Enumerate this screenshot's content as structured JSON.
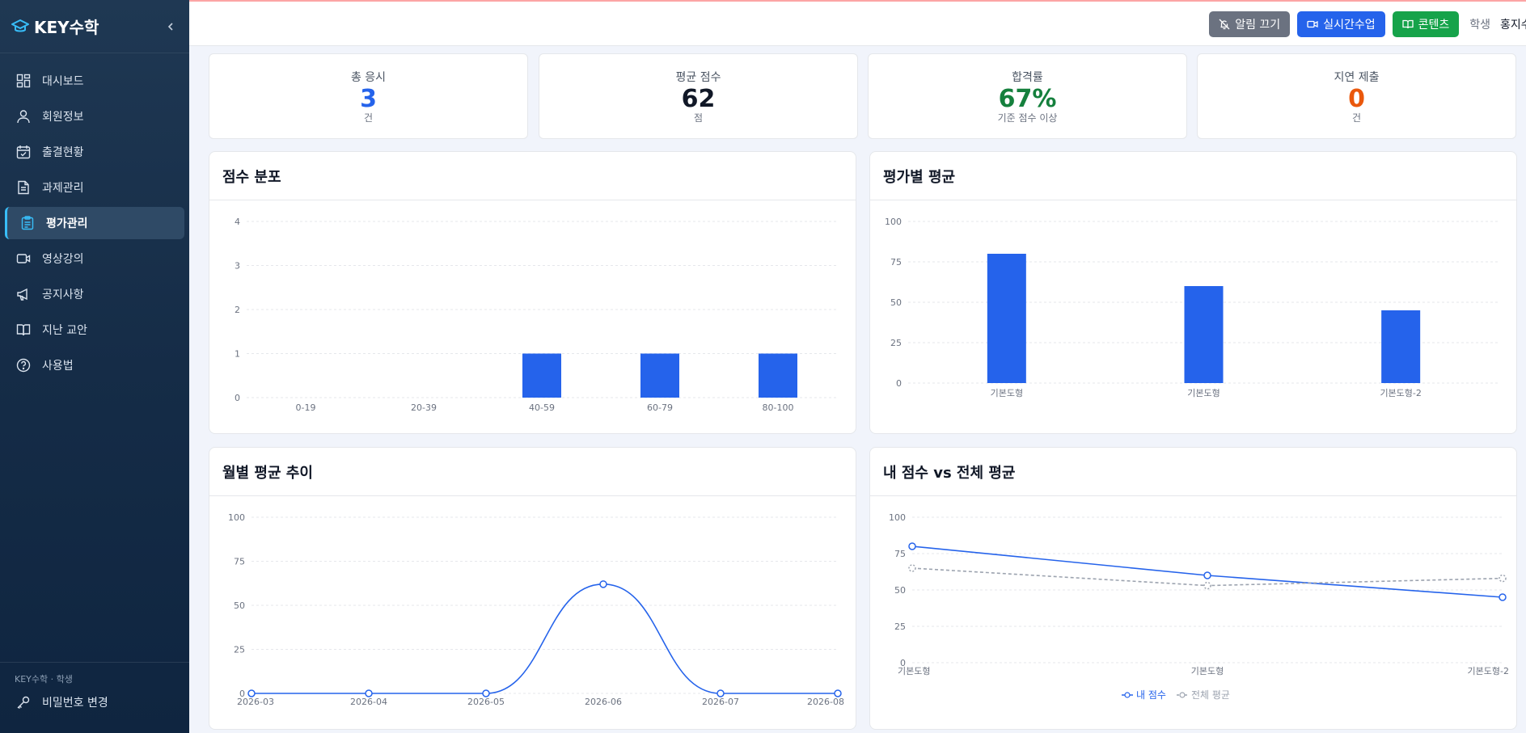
{
  "app": {
    "title": "KEY수학",
    "footer_role": "KEY수학 · 학생",
    "password_change": "비밀번호 변경"
  },
  "sidebar": {
    "items": [
      {
        "label": "대시보드",
        "icon": "dashboard-icon"
      },
      {
        "label": "회원정보",
        "icon": "user-icon"
      },
      {
        "label": "출결현황",
        "icon": "calendar-check-icon"
      },
      {
        "label": "과제관리",
        "icon": "document-icon"
      },
      {
        "label": "평가관리",
        "icon": "clipboard-icon",
        "active": true
      },
      {
        "label": "영상강의",
        "icon": "video-icon"
      },
      {
        "label": "공지사항",
        "icon": "megaphone-icon"
      },
      {
        "label": "지난 교안",
        "icon": "book-icon"
      },
      {
        "label": "사용법",
        "icon": "help-icon"
      }
    ]
  },
  "topbar": {
    "notify_off": "알림 끄기",
    "live_class": "실시간수업",
    "contents": "콘텐츠",
    "user_role": "학생",
    "user_name": "홍지수"
  },
  "stats": [
    {
      "label": "총 응시",
      "value": "3",
      "unit": "건",
      "color": "#2563eb"
    },
    {
      "label": "평균 점수",
      "value": "62",
      "unit": "점",
      "color": "#111827"
    },
    {
      "label": "합격률",
      "value": "67%",
      "unit": "기준 점수 이상",
      "color": "#15803d"
    },
    {
      "label": "지연 제출",
      "value": "0",
      "unit": "건",
      "color": "#ea580c"
    }
  ],
  "chart_data": [
    {
      "title": "점수 분포",
      "type": "bar",
      "categories": [
        "0-19",
        "20-39",
        "40-59",
        "60-79",
        "80-100"
      ],
      "values": [
        0,
        0,
        1,
        1,
        1
      ],
      "ylim": [
        0,
        4
      ],
      "yticks": [
        0,
        1,
        2,
        3,
        4
      ],
      "color": "#2563eb",
      "grid": true
    },
    {
      "title": "평가별 평균",
      "type": "bar",
      "categories": [
        "기본도형",
        "기본도형",
        "기본도형-2"
      ],
      "values": [
        80,
        60,
        45
      ],
      "ylim": [
        0,
        100
      ],
      "yticks": [
        0,
        25,
        50,
        75,
        100
      ],
      "color": "#2563eb",
      "grid": true
    },
    {
      "title": "월별 평균 추이",
      "type": "line",
      "categories": [
        "2026-03",
        "2026-04",
        "2026-05",
        "2026-06",
        "2026-07",
        "2026-08"
      ],
      "values": [
        0,
        0,
        0,
        62,
        0,
        0
      ],
      "ylim": [
        0,
        100
      ],
      "yticks": [
        0,
        25,
        50,
        75,
        100
      ],
      "color": "#2563eb",
      "grid": true
    },
    {
      "title": "내 점수 vs 전체 평균",
      "type": "line",
      "categories": [
        "기본도형",
        "기본도형",
        "기본도형-2"
      ],
      "series": [
        {
          "name": "내 점수",
          "values": [
            80,
            60,
            45
          ],
          "color": "#2563eb",
          "dashed": false
        },
        {
          "name": "전체 평균",
          "values": [
            65,
            53,
            58
          ],
          "color": "#9ca3af",
          "dashed": true
        }
      ],
      "ylim": [
        0,
        100
      ],
      "yticks": [
        0,
        25,
        50,
        75,
        100
      ],
      "legend": "bottom-center",
      "grid": true
    }
  ]
}
